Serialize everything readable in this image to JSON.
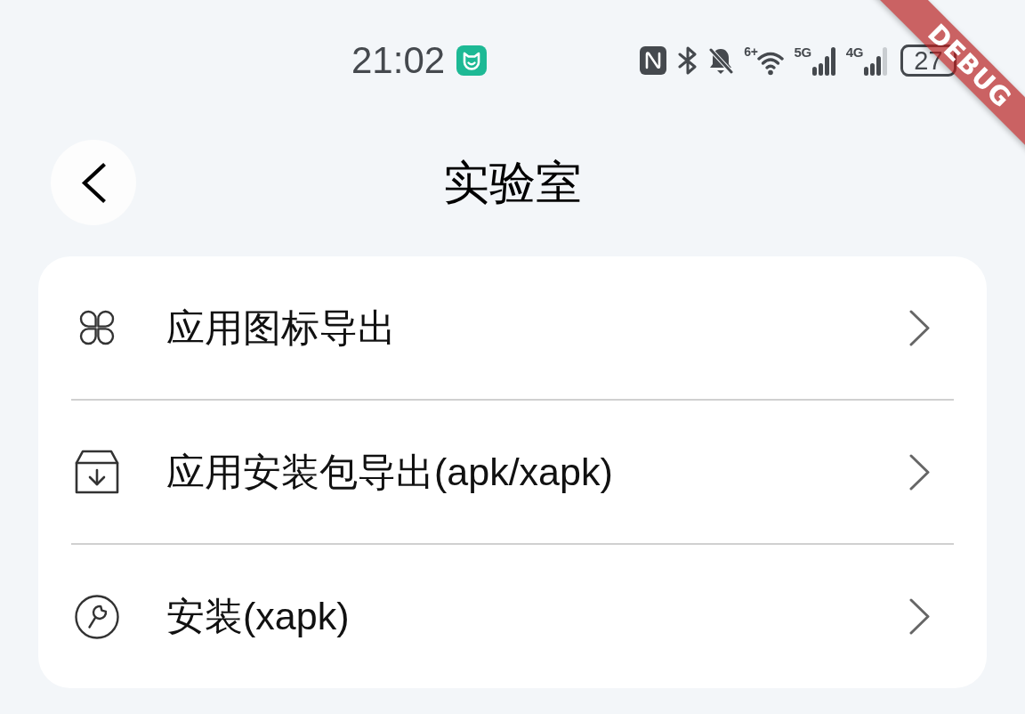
{
  "status_bar": {
    "time": "21:02",
    "wifi_label": "6+",
    "signals": [
      {
        "label": "5G"
      },
      {
        "label": "4G"
      }
    ],
    "battery": "27"
  },
  "debug_banner": "DEBUG",
  "header": {
    "title": "实验室"
  },
  "menu": [
    {
      "kind": "icons",
      "label": "应用图标导出"
    },
    {
      "kind": "package",
      "label": "应用安装包导出(apk/xapk)"
    },
    {
      "kind": "install",
      "label": "安装(xapk)"
    }
  ]
}
